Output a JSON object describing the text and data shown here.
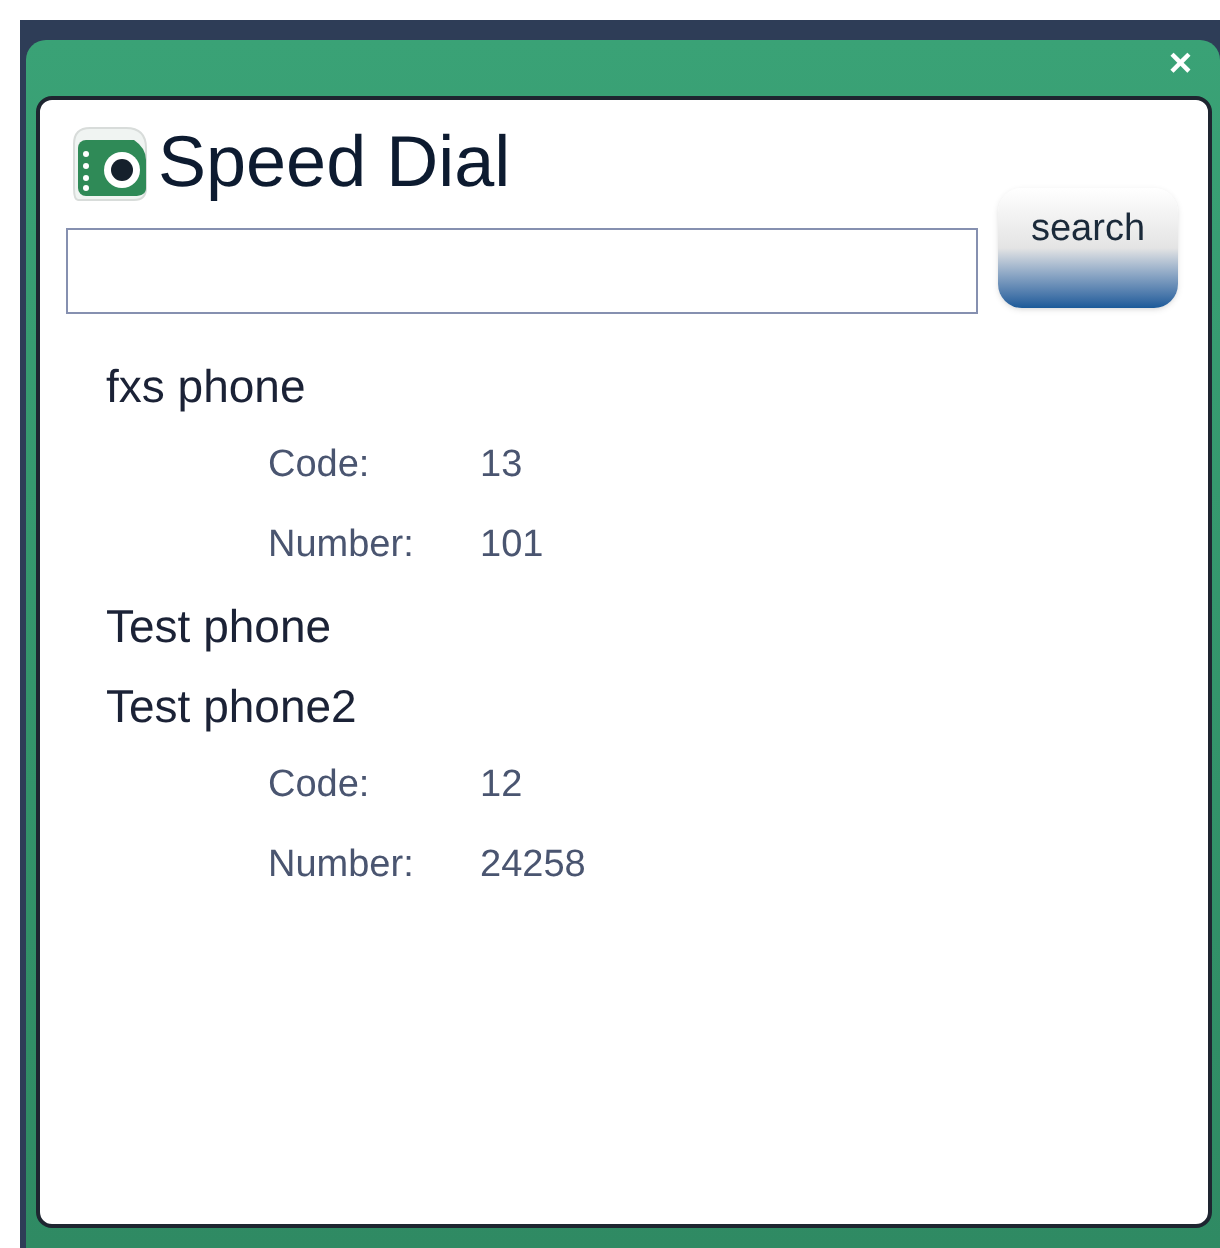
{
  "window": {
    "close": "×",
    "title": "Speed Dial"
  },
  "search": {
    "button": "search"
  },
  "contacts": [
    {
      "name": "fxs phone",
      "details": [
        {
          "label": "Code:",
          "value": "13"
        },
        {
          "label": "Number:",
          "value": "101"
        }
      ]
    },
    {
      "name": "Test phone"
    },
    {
      "name": "Test phone2",
      "details": [
        {
          "label": "Code:",
          "value": "12"
        },
        {
          "label": "Number:",
          "value": "24258"
        }
      ]
    }
  ]
}
